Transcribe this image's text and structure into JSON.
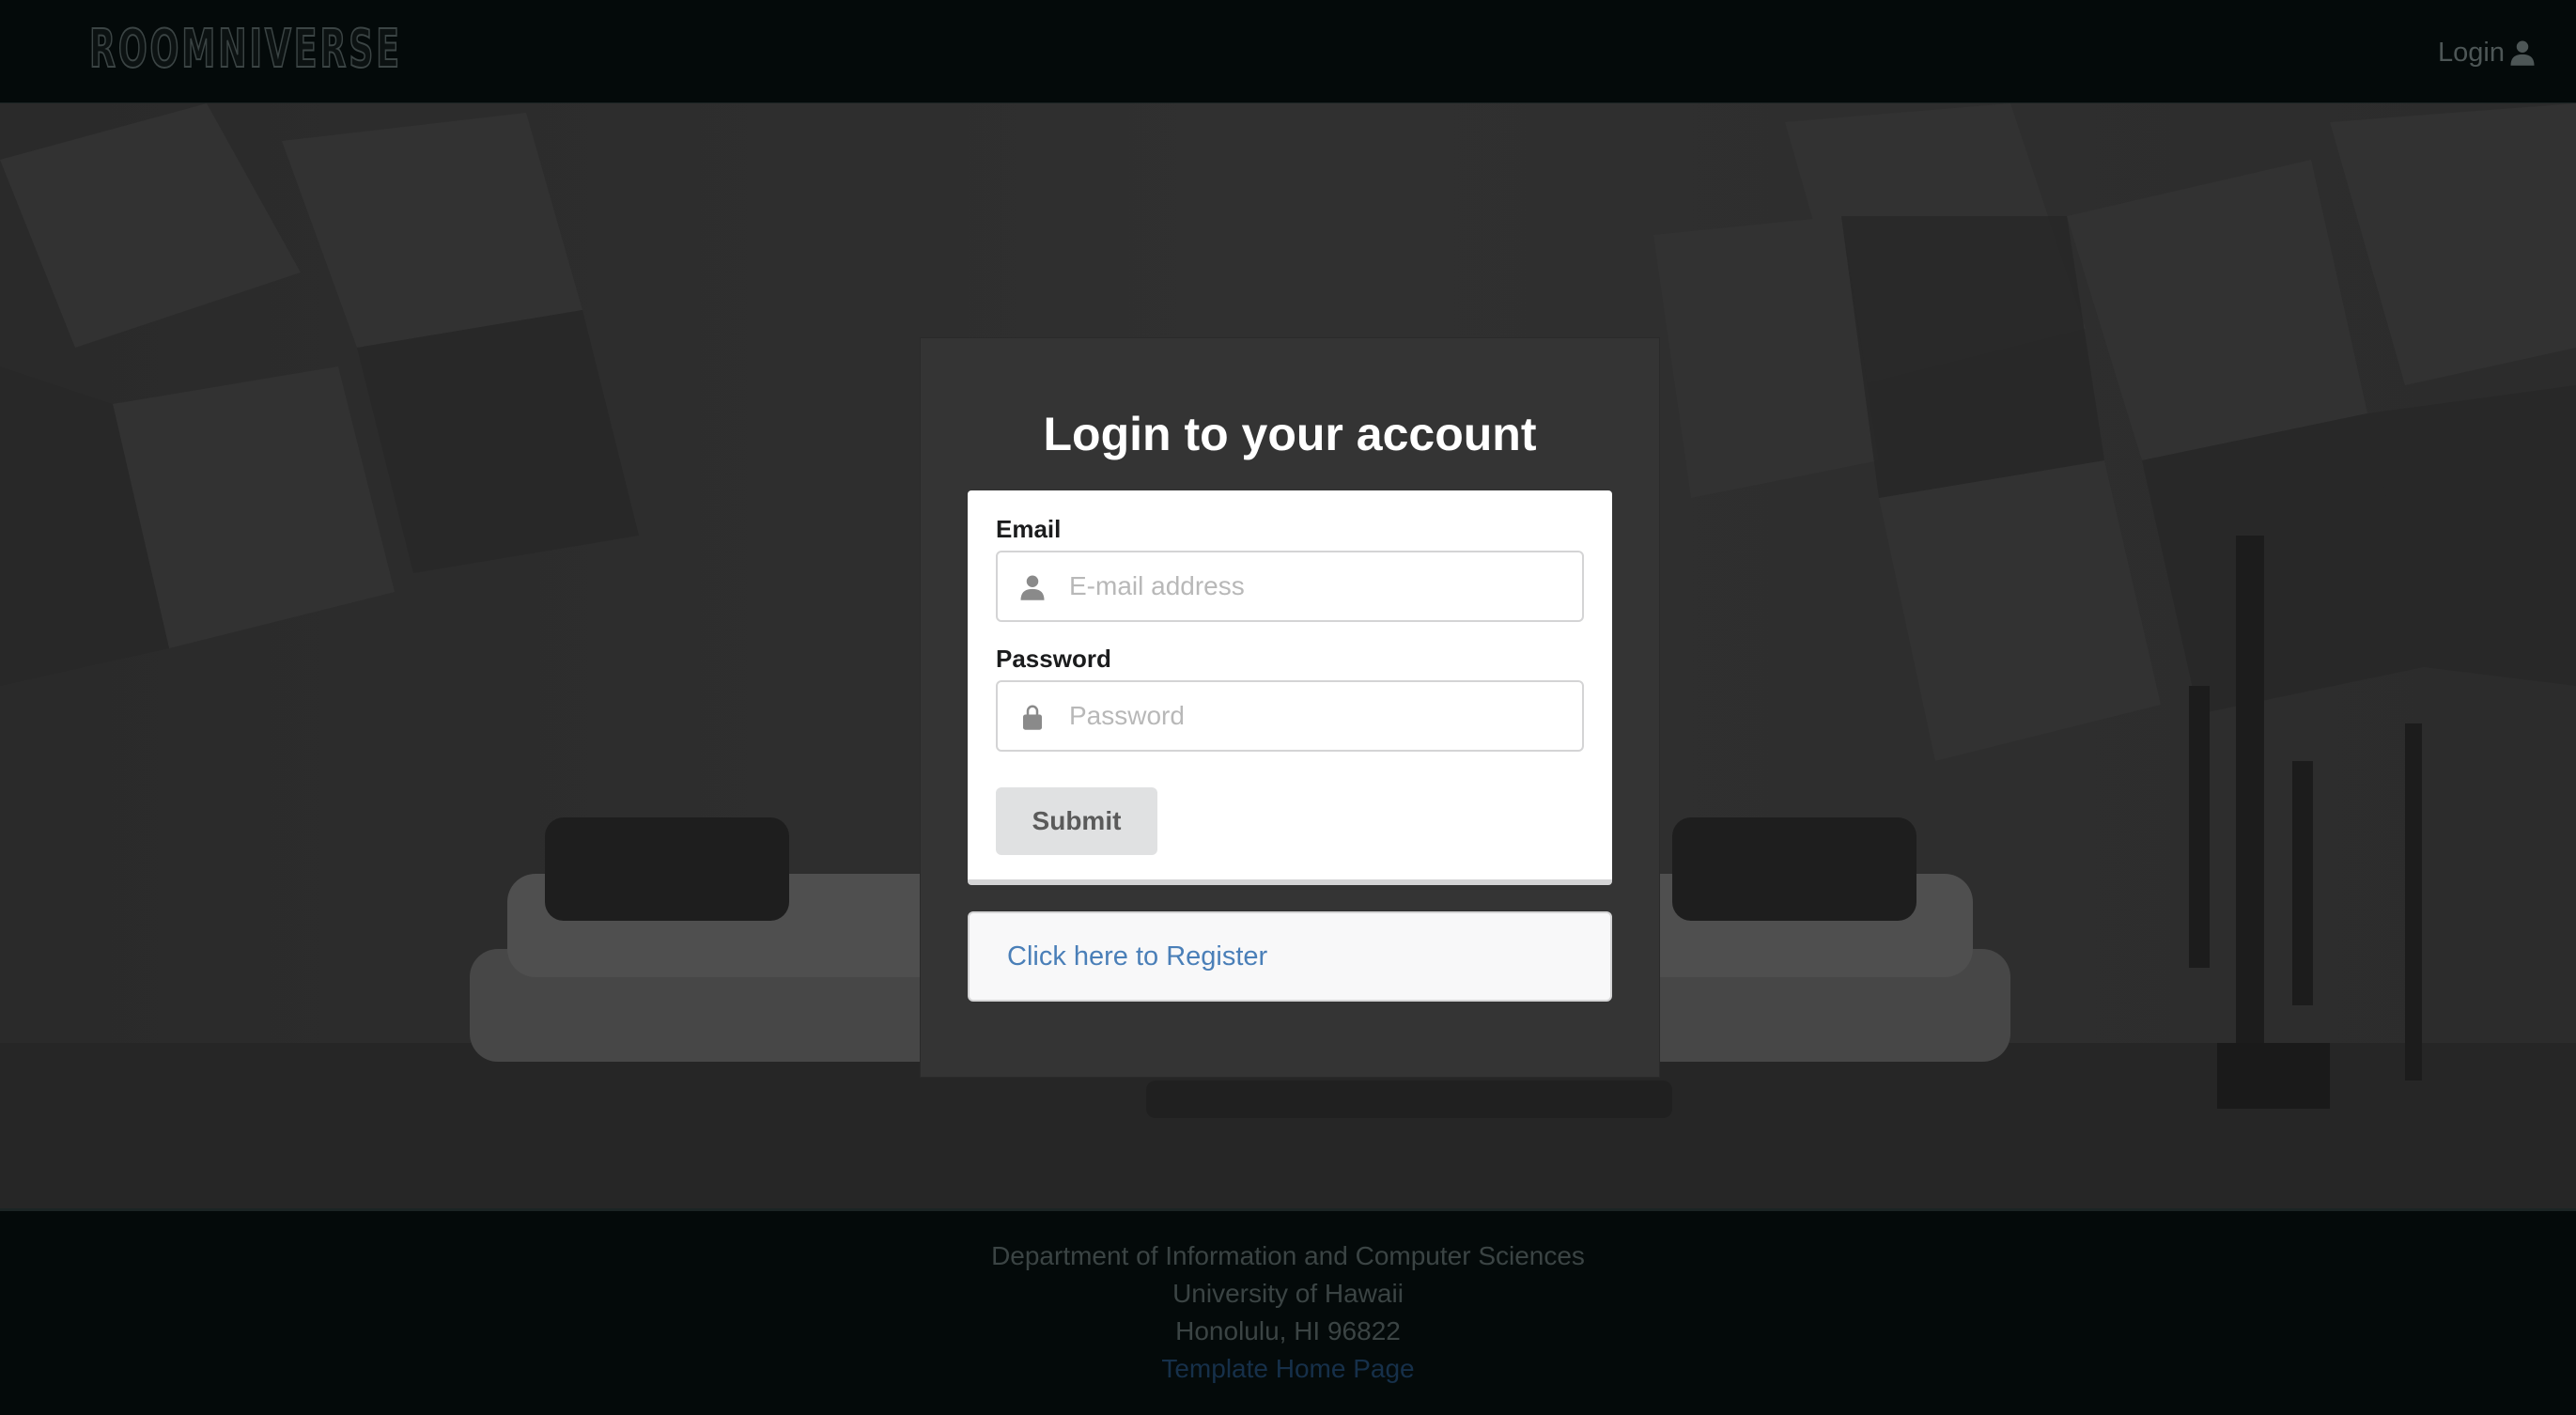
{
  "navbar": {
    "brand": "ROOMNIVERSE",
    "login_label": "Login",
    "login_icon": "user-icon"
  },
  "login_panel": {
    "title": "Login to your account",
    "email": {
      "label": "Email",
      "placeholder": "E-mail address",
      "value": "",
      "icon": "user-icon"
    },
    "password": {
      "label": "Password",
      "placeholder": "Password",
      "value": "",
      "icon": "lock-icon"
    },
    "submit_label": "Submit",
    "register_link": "Click here to Register"
  },
  "footer": {
    "line1": "Department of Information and Computer Sciences",
    "line2": "University of Hawaii",
    "line3": "Honolulu, HI 96822",
    "link": "Template Home Page"
  },
  "colors": {
    "navbar_bg": "#040a0a",
    "panel_bg": "#343434",
    "link_blue": "#4a7fb8",
    "button_grey": "#e0e1e2"
  }
}
